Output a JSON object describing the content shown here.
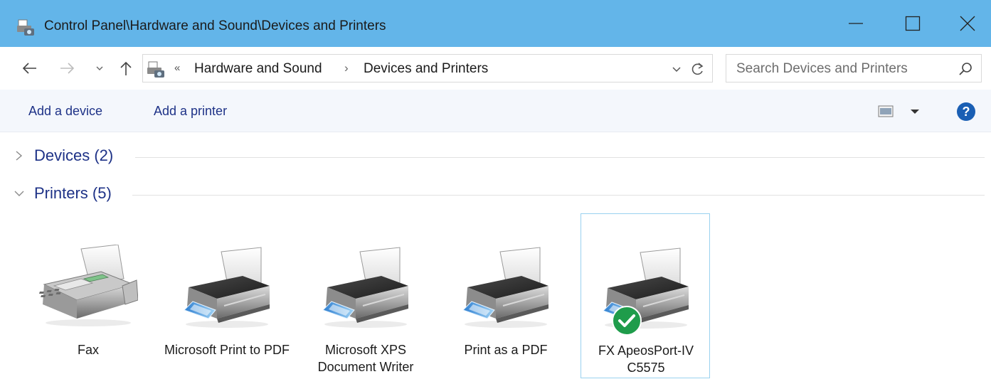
{
  "window": {
    "title": "Control Panel\\Hardware and Sound\\Devices and Printers",
    "icon": "devices-printers-icon",
    "minimize_icon": "minimize-icon",
    "maximize_icon": "maximize-icon",
    "close_icon": "close-icon"
  },
  "nav": {
    "back_icon": "back-arrow-icon",
    "forward_icon": "forward-arrow-icon",
    "recent_icon": "chevron-down-icon",
    "up_icon": "up-arrow-icon",
    "overflow": "«",
    "breadcrumb": [
      "Hardware and Sound",
      "Devices and Printers"
    ],
    "separator": "›",
    "dropdown_icon": "chevron-down-icon",
    "refresh_icon": "refresh-icon"
  },
  "search": {
    "placeholder": "Search Devices and Printers",
    "value": "",
    "icon": "search-icon"
  },
  "commands": {
    "add_device": "Add a device",
    "add_printer": "Add a printer",
    "view_icon": "change-view-icon",
    "help_icon": "help-icon"
  },
  "groups": {
    "devices": {
      "label": "Devices (2)",
      "expanded": false
    },
    "printers": {
      "label": "Printers (5)",
      "expanded": true
    }
  },
  "printers": [
    {
      "label": "Fax",
      "icon": "fax-icon",
      "default": false,
      "selected": false
    },
    {
      "label": "Microsoft Print to PDF",
      "icon": "printer-icon",
      "default": false,
      "selected": false
    },
    {
      "label": "Microsoft XPS Document Writer",
      "icon": "printer-icon",
      "default": false,
      "selected": false
    },
    {
      "label": "Print as a PDF",
      "icon": "printer-icon",
      "default": false,
      "selected": false
    },
    {
      "label": "FX ApeosPort-IV C5575",
      "icon": "printer-icon",
      "default": true,
      "selected": true
    }
  ],
  "colors": {
    "titlebar": "#63b5e9",
    "link": "#1e3287",
    "selection_border": "#99d1ef",
    "default_badge": "#1f9c4b"
  }
}
